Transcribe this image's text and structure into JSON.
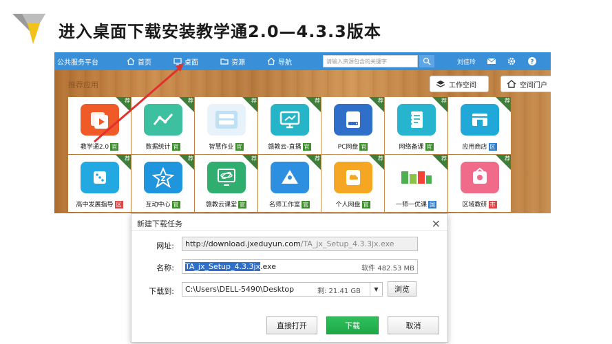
{
  "slide": {
    "title": "进入桌面下载安装教学通2.0—4.3.3版本"
  },
  "portal": {
    "brand": "公共服务平台",
    "nav": [
      {
        "label": "首页",
        "icon": "home-icon"
      },
      {
        "label": "桌面",
        "icon": "monitor-icon"
      },
      {
        "label": "资源",
        "icon": "folder-icon"
      },
      {
        "label": "导航",
        "icon": "home-icon"
      }
    ],
    "search_placeholder": "请输入资源包含的关键字",
    "user": "刘佳玲",
    "recommend_label": "推荐应用",
    "workspace_button": "工作空间",
    "portal_button": "空间门户",
    "rec_tag": "荐",
    "colors": {
      "nav": "#3a8fd9",
      "arrow": "#e03030",
      "badge_green": "#3f8f2f",
      "badge_red": "#e04545",
      "badge_blue": "#2f7fd0"
    },
    "apps": [
      {
        "name": "教学通2.0",
        "badge": "官",
        "badge_color": "#3f8f2f",
        "icon": "video-play-icon",
        "color": "#f05a28"
      },
      {
        "name": "数据统计",
        "badge": "官",
        "badge_color": "#3f8f2f",
        "icon": "chart-line-icon",
        "color": "#3dc0a0"
      },
      {
        "name": "智慧作业",
        "badge": "官",
        "badge_color": "#3f8f2f",
        "icon": "homework-icon",
        "color": "#e8f2fb"
      },
      {
        "name": "赣教云-直播",
        "badge": "官",
        "badge_color": "#3f8f2f",
        "icon": "live-screen-icon",
        "color": "#25b4c8"
      },
      {
        "name": "PC网盘",
        "badge": "官",
        "badge_color": "#3f8f2f",
        "icon": "disk-icon",
        "color": "#2f6fc9"
      },
      {
        "name": "网络备课",
        "badge": "官",
        "badge_color": "#3f8f2f",
        "icon": "notebook-icon",
        "color": "#26b4cf"
      },
      {
        "name": "应用商店",
        "badge": "区",
        "badge_color": "#2f7fd0",
        "icon": "store-icon",
        "color": "#20a8d8"
      },
      {
        "name": "高中发展指导",
        "badge": "区",
        "badge_color": "#e04545",
        "icon": "dice-icon",
        "color": "#23a9e1"
      },
      {
        "name": "互动中心",
        "badge": "官",
        "badge_color": "#3f8f2f",
        "icon": "star-z-icon",
        "color": "#1f95dd"
      },
      {
        "name": "赣教云课堂",
        "badge": "官",
        "badge_color": "#3f8f2f",
        "icon": "atom-icon",
        "color": "#2fae6f"
      },
      {
        "name": "名师工作室",
        "badge": "官",
        "badge_color": "#3f8f2f",
        "icon": "teacher-icon",
        "color": "#2d8fe0"
      },
      {
        "name": "个人网盘",
        "badge": "官",
        "badge_color": "#3f8f2f",
        "icon": "cloud-disk-icon",
        "color": "#f5a623"
      },
      {
        "name": "一师一优课",
        "badge": "国",
        "badge_color": "#2f7fd0",
        "icon": "lesson-icon",
        "color": "#ffffff"
      },
      {
        "name": "区域教研",
        "badge": "市",
        "badge_color": "#e04545",
        "icon": "research-icon",
        "color": "#f06b8a"
      }
    ]
  },
  "dialog": {
    "title": "新建下载任务",
    "url_label": "网址:",
    "url_host": "http://download.jxeduyun.com",
    "url_path": "/TA_jx_Setup_4.3.3jx.exe",
    "name_label": "名称:",
    "name_selected": "TA_jx_Setup_4.3.3jx",
    "name_ext": ".exe",
    "size": "软件 482.53 MB",
    "download_to_label": "下载到:",
    "path": "C:\\Users\\DELL-5490\\Desktop",
    "free_space": "剩: 21.41 GB",
    "browse": "浏览",
    "open_direct": "直接打开",
    "download": "下载",
    "cancel": "取消"
  }
}
